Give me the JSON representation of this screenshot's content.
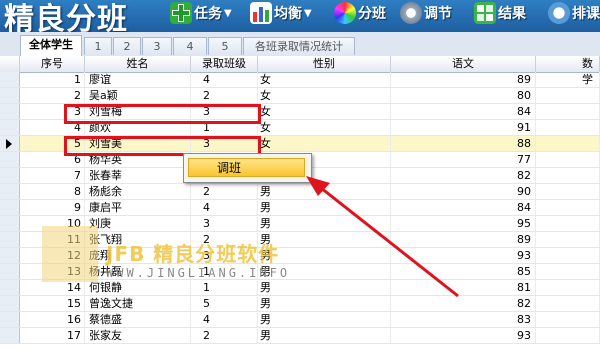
{
  "app": {
    "title": "精良分班"
  },
  "toolbar": [
    {
      "label": "任务",
      "icon": "plus-icon",
      "dropdown": true
    },
    {
      "label": "均衡",
      "icon": "bar-chart-icon",
      "dropdown": true
    },
    {
      "label": "分班",
      "icon": "color-wheel-icon"
    },
    {
      "label": "调节",
      "icon": "gear-icon"
    },
    {
      "label": "结果",
      "icon": "grid-result-icon"
    },
    {
      "label": "排课",
      "icon": "schedule-icon"
    }
  ],
  "tabs": [
    "全体学生",
    "1",
    "2",
    "3",
    "4",
    "5",
    "各班录取情况统计"
  ],
  "grid": {
    "columns": [
      "序号",
      "姓名",
      "录取班级",
      "性别",
      "语文",
      "数学"
    ],
    "rows": [
      [
        "1",
        "廖谊",
        "4",
        "女",
        "89"
      ],
      [
        "2",
        "吴a颖",
        "2",
        "女",
        "80"
      ],
      [
        "3",
        "刘雪梅",
        "3",
        "女",
        "84"
      ],
      [
        "4",
        "颜欢",
        "1",
        "女",
        "91"
      ],
      [
        "5",
        "刘雪美",
        "3",
        "女",
        "88"
      ],
      [
        "6",
        "杨华英",
        "",
        "",
        "77"
      ],
      [
        "7",
        "张春莘",
        "",
        "",
        "82"
      ],
      [
        "8",
        "杨彪余",
        "2",
        "男",
        "90"
      ],
      [
        "9",
        "康启平",
        "4",
        "男",
        "84"
      ],
      [
        "10",
        "刘庚",
        "3",
        "男",
        "95"
      ],
      [
        "11",
        "张飞翔",
        "2",
        "男",
        "89"
      ],
      [
        "12",
        "庞翔",
        "3",
        "男",
        "93"
      ],
      [
        "13",
        "杨井磊",
        "1",
        "男",
        "85"
      ],
      [
        "14",
        "何银静",
        "1",
        "男",
        "81"
      ],
      [
        "15",
        "曾逸文捷",
        "5",
        "男",
        "82"
      ],
      [
        "16",
        "蔡德盛",
        "4",
        "男",
        "83"
      ],
      [
        "17",
        "张家友",
        "2",
        "男",
        "93"
      ]
    ],
    "selected_row": "5"
  },
  "context_menu": {
    "items": [
      "调班"
    ]
  },
  "watermark": {
    "line1": "JFB 精良分班软件",
    "line2": "WWW.JINGLIANG.INFO"
  }
}
